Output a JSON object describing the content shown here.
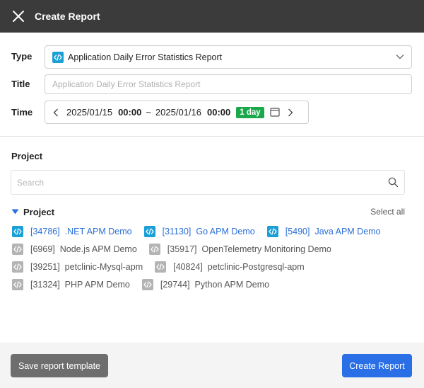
{
  "header": {
    "title": "Create Report"
  },
  "form": {
    "type_label": "Type",
    "type_value": "Application Daily Error Statistics Report",
    "title_label": "Title",
    "title_placeholder": "Application Daily Error Statistics Report",
    "title_value": "",
    "time_label": "Time",
    "time": {
      "start_date": "2025/01/15",
      "start_time": "00:00",
      "separator": "~",
      "end_date": "2025/01/16",
      "end_time": "00:00",
      "range_badge": "1 day"
    }
  },
  "project_section": {
    "title": "Project",
    "search_placeholder": "Search",
    "group_label": "Project",
    "select_all": "Select all",
    "rows": [
      [
        {
          "id": "[34786]",
          "name": ".NET APM Demo",
          "selected": true
        },
        {
          "id": "[31130]",
          "name": "Go APM Demo",
          "selected": true
        },
        {
          "id": "[5490]",
          "name": "Java APM Demo",
          "selected": true
        }
      ],
      [
        {
          "id": "[6969]",
          "name": "Node.js APM Demo",
          "selected": false
        },
        {
          "id": "[35917]",
          "name": "OpenTelemetry Monitoring Demo",
          "selected": false
        }
      ],
      [
        {
          "id": "[39251]",
          "name": "petclinic-Mysql-apm",
          "selected": false
        },
        {
          "id": "[40824]",
          "name": "petclinic-Postgresql-apm",
          "selected": false
        }
      ],
      [
        {
          "id": "[31324]",
          "name": "PHP APM Demo",
          "selected": false
        },
        {
          "id": "[29744]",
          "name": "Python APM Demo",
          "selected": false
        }
      ]
    ]
  },
  "footer": {
    "save_template_label": "Save report template",
    "create_label": "Create Report"
  },
  "colors": {
    "header_bg": "#3b3b3b",
    "accent_blue": "#2a6fe6",
    "selected_icon": "#1aa0d6",
    "unselected_icon": "#b4b4b4",
    "badge_green": "#1aa84a",
    "template_button": "#6e6e6e"
  },
  "icons": {
    "close": "close-icon",
    "app_type": "code-icon",
    "chevron": "chevron-down-icon",
    "prev": "chevron-left-icon",
    "next": "chevron-right-icon",
    "calendar": "calendar-icon",
    "search": "search-icon",
    "collapse": "triangle-down-icon"
  }
}
